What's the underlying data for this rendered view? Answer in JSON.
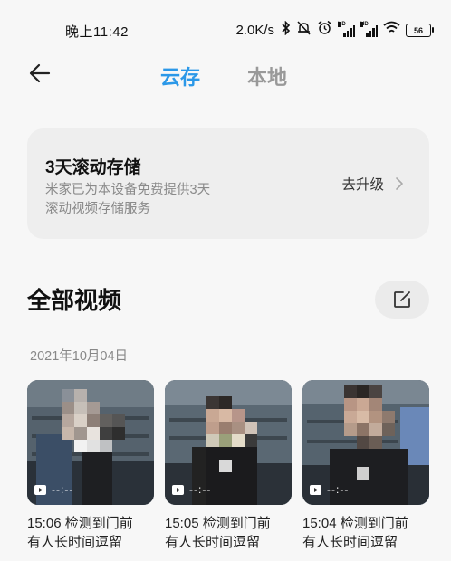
{
  "status_bar": {
    "time": "晚上11:42",
    "network_speed": "2.0K/s",
    "battery": "56",
    "icons": [
      "bluetooth-icon",
      "mute-icon",
      "alarm-icon",
      "signal-hd-icon",
      "signal-hd-icon",
      "wifi-icon",
      "battery-icon"
    ]
  },
  "header": {
    "tabs": [
      {
        "label": "云存",
        "active": true
      },
      {
        "label": "本地",
        "active": false
      }
    ],
    "accent_color": "#2b98e8"
  },
  "upgrade_card": {
    "title": "3天滚动存储",
    "description_line1": "米家已为本设备免费提供3天",
    "description_line2": "滚动视频存储服务",
    "button_label": "去升级"
  },
  "section": {
    "title": "全部视频",
    "date": "2021年10月04日"
  },
  "videos": [
    {
      "duration": "--:--",
      "caption_line1": "15:06 检测到门前",
      "caption_line2": "有人长时间逗留"
    },
    {
      "duration": "--:--",
      "caption_line1": "15:05 检测到门前",
      "caption_line2": "有人长时间逗留"
    },
    {
      "duration": "--:--",
      "caption_line1": "15:04 检测到门前",
      "caption_line2": "有人长时间逗留"
    }
  ]
}
